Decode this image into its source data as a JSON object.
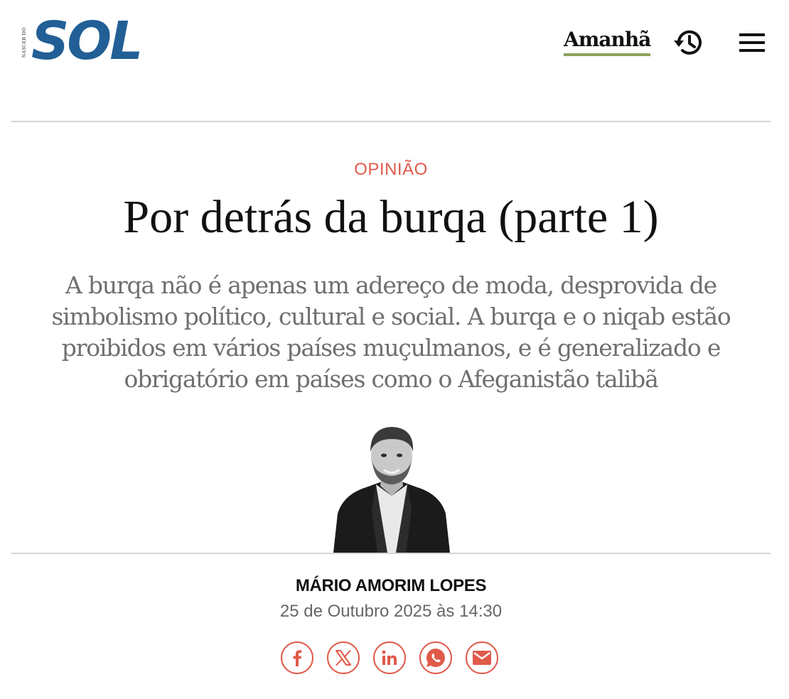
{
  "header": {
    "logo_small": "NASCER DO",
    "logo_big": "SOL",
    "nav_amanha": "Amanhã",
    "history_icon": "history-icon",
    "menu_icon": "hamburger-menu-icon",
    "accent_color": "#225f96",
    "underline_color": "#8aa35a"
  },
  "article": {
    "category": "OPINIÃO",
    "title": "Por detrás da burqa (parte 1)",
    "lead": "A burqa não é apenas um adereço de moda, desprovida de simbolismo político, cultural e social. A burqa e o niqab estão proibidos em vários países muçulmanos, e é generalizado e obrigatório em países como o Afeganistão talibã",
    "author": "MÁRIO AMORIM LOPES",
    "date": "25 de Outubro 2025 às 14:30",
    "category_color": "#e05a4a"
  },
  "share": {
    "buttons": [
      "facebook-icon",
      "x-icon",
      "linkedin-icon",
      "whatsapp-icon",
      "email-icon"
    ],
    "color": "#e05a4a"
  }
}
